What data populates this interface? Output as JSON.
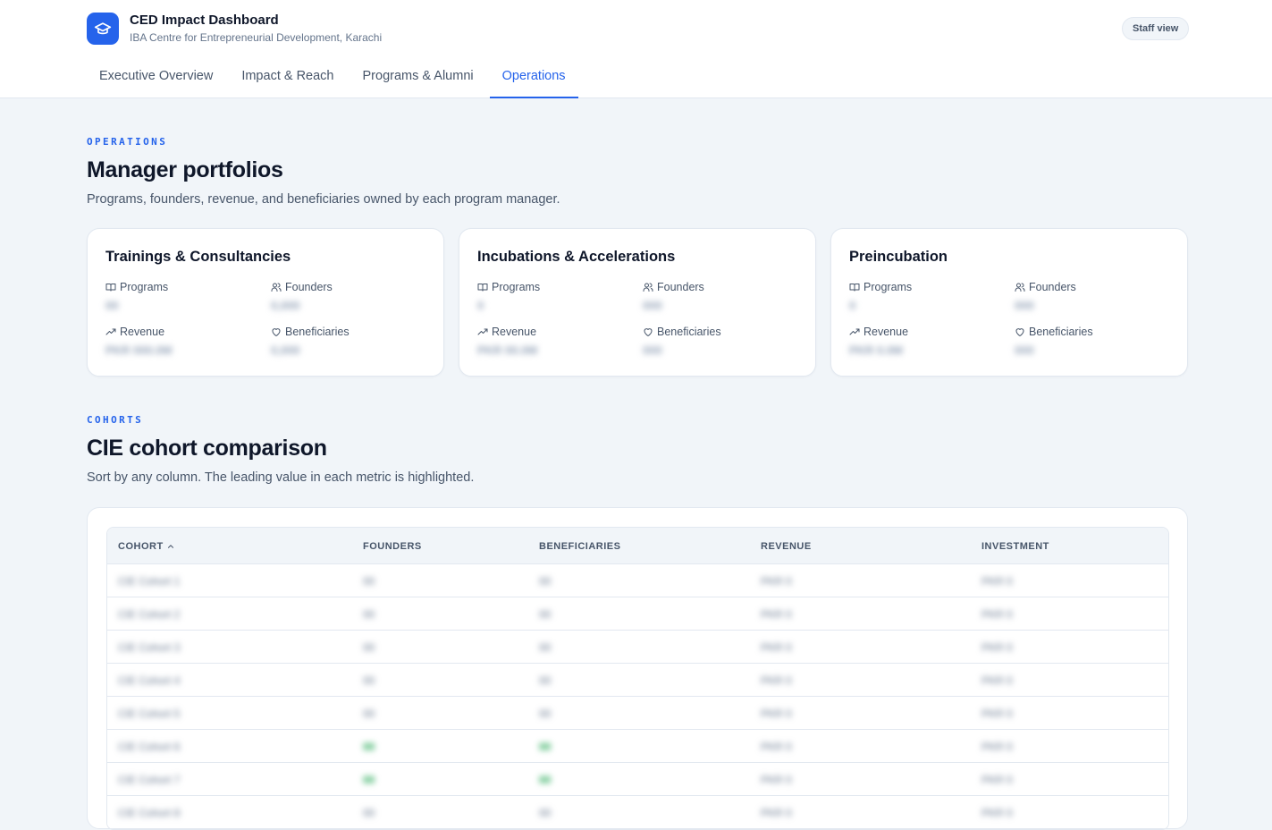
{
  "header": {
    "app_title": "CED Impact Dashboard",
    "app_subtitle": "IBA Centre for Entrepreneurial Development, Karachi",
    "staff_label": "Staff view",
    "logo_icon": "graduation-cap-icon",
    "accent_color": "#2563eb"
  },
  "tabs": [
    {
      "label": "Executive Overview",
      "active": false
    },
    {
      "label": "Impact & Reach",
      "active": false
    },
    {
      "label": "Programs & Alumni",
      "active": false
    },
    {
      "label": "Operations",
      "active": true
    }
  ],
  "operations": {
    "eyebrow": "OPERATIONS",
    "title": "Manager portfolios",
    "description": "Programs, founders, revenue, and beneficiaries owned by each program manager."
  },
  "portfolios": [
    {
      "title": "Trainings & Consultancies",
      "labels": {
        "programs": "Programs",
        "founders": "Founders",
        "revenue": "Revenue",
        "beneficiaries": "Beneficiaries"
      },
      "values": {
        "programs": "00",
        "founders": "0,000",
        "revenue": "PKR 000.0M",
        "beneficiaries": "0,000"
      }
    },
    {
      "title": "Incubations & Accelerations",
      "labels": {
        "programs": "Programs",
        "founders": "Founders",
        "revenue": "Revenue",
        "beneficiaries": "Beneficiaries"
      },
      "values": {
        "programs": "0",
        "founders": "000",
        "revenue": "PKR 00.0M",
        "beneficiaries": "000"
      }
    },
    {
      "title": "Preincubation",
      "labels": {
        "programs": "Programs",
        "founders": "Founders",
        "revenue": "Revenue",
        "beneficiaries": "Beneficiaries"
      },
      "values": {
        "programs": "0",
        "founders": "000",
        "revenue": "PKR 0.0M",
        "beneficiaries": "000"
      }
    }
  ],
  "cohorts": {
    "eyebrow": "COHORTS",
    "title": "CIE cohort comparison",
    "description": "Sort by any column. The leading value in each metric is highlighted.",
    "columns": [
      "COHORT",
      "FOUNDERS",
      "BENEFICIARIES",
      "REVENUE",
      "INVESTMENT"
    ],
    "sort_column": "COHORT",
    "sort_icon": "chevron-up-icon",
    "highlight_color": "#16a34a",
    "rows": [
      {
        "cohort": "CIE Cohort 1",
        "founders": "00",
        "beneficiaries": "00",
        "revenue": "PKR 0",
        "investment": "PKR 0",
        "highlight": false
      },
      {
        "cohort": "CIE Cohort 2",
        "founders": "00",
        "beneficiaries": "00",
        "revenue": "PKR 0",
        "investment": "PKR 0",
        "highlight": false
      },
      {
        "cohort": "CIE Cohort 3",
        "founders": "00",
        "beneficiaries": "00",
        "revenue": "PKR 0",
        "investment": "PKR 0",
        "highlight": false
      },
      {
        "cohort": "CIE Cohort 4",
        "founders": "00",
        "beneficiaries": "00",
        "revenue": "PKR 0",
        "investment": "PKR 0",
        "highlight": false
      },
      {
        "cohort": "CIE Cohort 5",
        "founders": "00",
        "beneficiaries": "00",
        "revenue": "PKR 0",
        "investment": "PKR 0",
        "highlight": false
      },
      {
        "cohort": "CIE Cohort 6",
        "founders": "00",
        "beneficiaries": "00",
        "revenue": "PKR 0",
        "investment": "PKR 0",
        "highlight": true
      },
      {
        "cohort": "CIE Cohort 7",
        "founders": "00",
        "beneficiaries": "00",
        "revenue": "PKR 0",
        "investment": "PKR 0",
        "highlight": true
      },
      {
        "cohort": "CIE Cohort 8",
        "founders": "00",
        "beneficiaries": "00",
        "revenue": "PKR 0",
        "investment": "PKR 0",
        "highlight": false
      }
    ]
  }
}
